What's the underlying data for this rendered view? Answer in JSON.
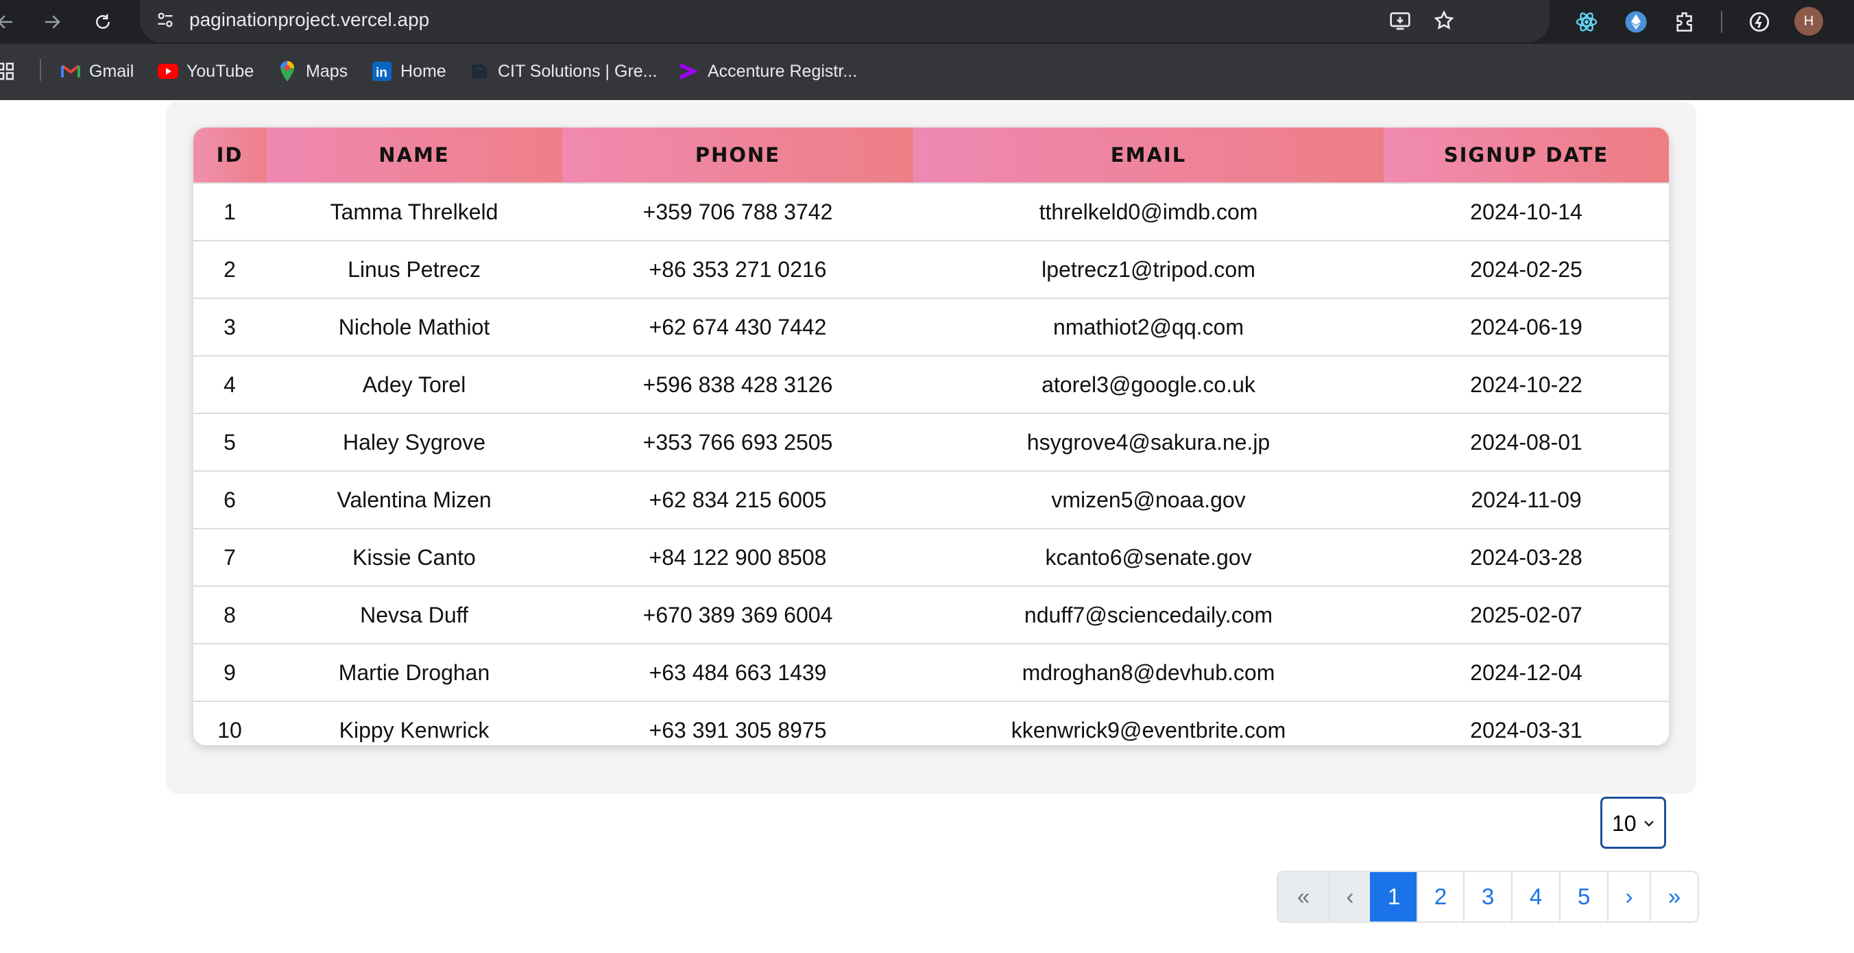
{
  "browser": {
    "url": "paginationproject.vercel.app",
    "profile_initial": "H",
    "bookmarks": [
      {
        "label": "Gmail",
        "icon": "gmail-icon"
      },
      {
        "label": "YouTube",
        "icon": "youtube-icon"
      },
      {
        "label": "Maps",
        "icon": "maps-icon"
      },
      {
        "label": "Home",
        "icon": "linkedin-icon"
      },
      {
        "label": "CIT Solutions | Gre...",
        "icon": "cit-icon"
      },
      {
        "label": "Accenture Registr...",
        "icon": "accenture-icon"
      }
    ]
  },
  "table": {
    "headers": [
      "ID",
      "NAME",
      "PHONE",
      "EMAIL",
      "SIGNUP DATE"
    ],
    "rows": [
      {
        "id": "1",
        "name": "Tamma Threlkeld",
        "phone": "+359 706 788 3742",
        "email": "tthrelkeld0@imdb.com",
        "date": "2024-10-14"
      },
      {
        "id": "2",
        "name": "Linus Petrecz",
        "phone": "+86 353 271 0216",
        "email": "lpetrecz1@tripod.com",
        "date": "2024-02-25"
      },
      {
        "id": "3",
        "name": "Nichole Mathiot",
        "phone": "+62 674 430 7442",
        "email": "nmathiot2@qq.com",
        "date": "2024-06-19"
      },
      {
        "id": "4",
        "name": "Adey Torel",
        "phone": "+596 838 428 3126",
        "email": "atorel3@google.co.uk",
        "date": "2024-10-22"
      },
      {
        "id": "5",
        "name": "Haley Sygrove",
        "phone": "+353 766 693 2505",
        "email": "hsygrove4@sakura.ne.jp",
        "date": "2024-08-01"
      },
      {
        "id": "6",
        "name": "Valentina Mizen",
        "phone": "+62 834 215 6005",
        "email": "vmizen5@noaa.gov",
        "date": "2024-11-09"
      },
      {
        "id": "7",
        "name": "Kissie Canto",
        "phone": "+84 122 900 8508",
        "email": "kcanto6@senate.gov",
        "date": "2024-03-28"
      },
      {
        "id": "8",
        "name": "Nevsa Duff",
        "phone": "+670 389 369 6004",
        "email": "nduff7@sciencedaily.com",
        "date": "2025-02-07"
      },
      {
        "id": "9",
        "name": "Martie Droghan",
        "phone": "+63 484 663 1439",
        "email": "mdroghan8@devhub.com",
        "date": "2024-12-04"
      },
      {
        "id": "10",
        "name": "Kippy Kenwrick",
        "phone": "+63 391 305 8975",
        "email": "kkenwrick9@eventbrite.com",
        "date": "2024-03-31"
      }
    ]
  },
  "page_size": {
    "value": "10"
  },
  "pagination": {
    "first": "«",
    "prev": "‹",
    "pages": [
      "1",
      "2",
      "3",
      "4",
      "5"
    ],
    "current": "1",
    "next": "›",
    "last": "»"
  },
  "colors": {
    "header_pink": "#ef89b2",
    "header_salmon": "#ee7f88",
    "active_page": "#1a73e8",
    "select_border": "#1d4f9a"
  }
}
